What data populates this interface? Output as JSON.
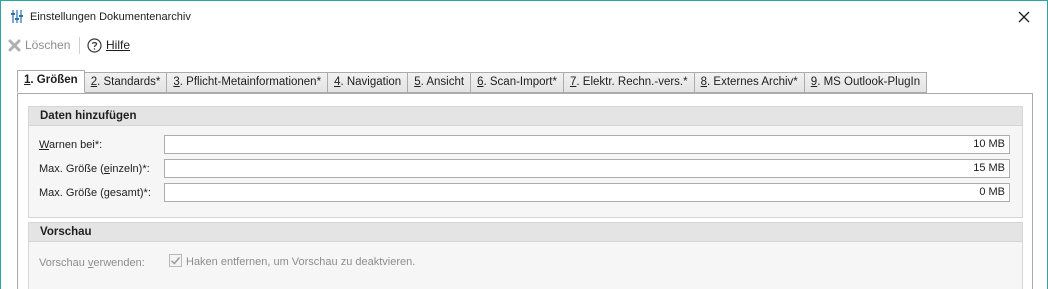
{
  "window": {
    "title": "Einstellungen Dokumentenarchiv",
    "accent_color": "#2aa8a0",
    "title_icon": "sliders-icon",
    "close_icon": "close-icon"
  },
  "toolbar": {
    "delete_label": "Löschen",
    "delete_icon": "delete-x-icon",
    "help_label": "Hilfe",
    "help_icon": "help-circle-icon"
  },
  "tabs": [
    {
      "num": "1",
      "label": ". Größen",
      "active": true
    },
    {
      "num": "2",
      "label": ". Standards*"
    },
    {
      "num": "3",
      "label": ". Pflicht-Metainformationen*"
    },
    {
      "num": "4",
      "label": ". Navigation"
    },
    {
      "num": "5",
      "label": ". Ansicht"
    },
    {
      "num": "6",
      "label": ". Scan-Import*"
    },
    {
      "num": "7",
      "label": ". Elektr. Rechn.-vers.*"
    },
    {
      "num": "8",
      "label": ". Externes Archiv*"
    },
    {
      "num": "9",
      "label": ". MS Outlook-PlugIn"
    }
  ],
  "daten": {
    "heading": "Daten hinzufügen",
    "warnen": {
      "pre": "",
      "ul": "W",
      "post": "arnen bei*:",
      "value": "10 MB"
    },
    "einzeln": {
      "pre": "Max. Größe (",
      "ul": "e",
      "post": "inzeln)*:",
      "value": "15 MB"
    },
    "gesamt": {
      "pre": "Max. Größe (",
      "ul": "g",
      "post": "esamt)*:",
      "value": "0 MB"
    }
  },
  "vorschau": {
    "heading": "Vorschau",
    "label_pre": "Vorschau ",
    "label_ul": "v",
    "label_post": "erwenden:",
    "checked": true,
    "check_text": "Haken entfernen, um Vorschau zu deaktvieren."
  }
}
